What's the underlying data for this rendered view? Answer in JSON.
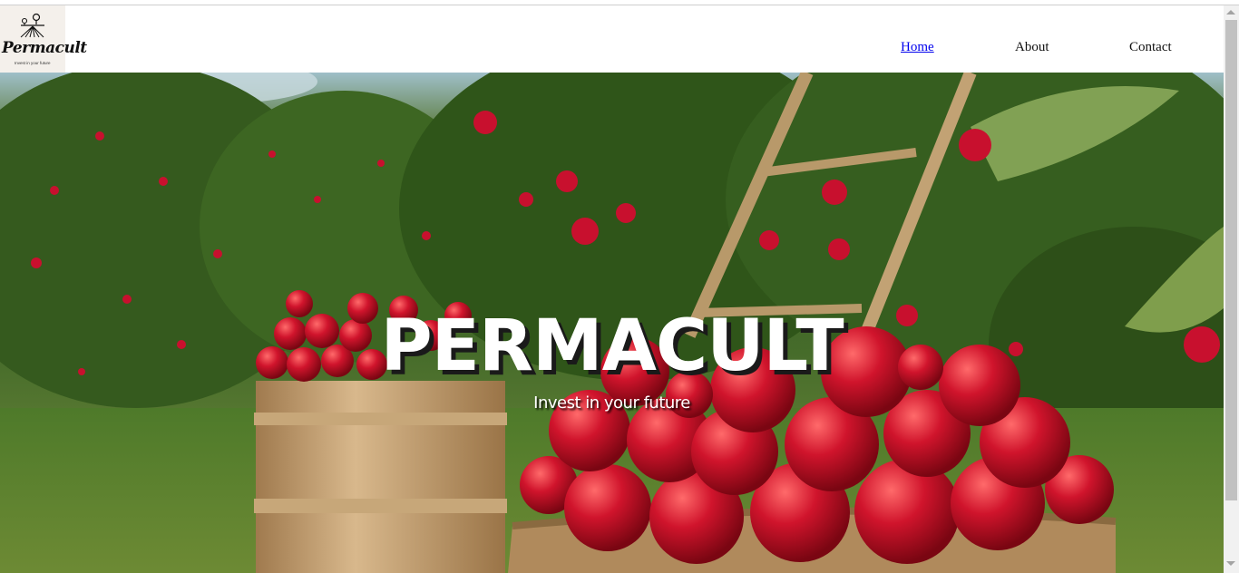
{
  "brand": {
    "name": "Permacult",
    "tagline": "Invest in your future",
    "logo_icon": "tree-garden-icon"
  },
  "nav": {
    "items": [
      {
        "label": "Home",
        "active": true
      },
      {
        "label": "About",
        "active": false
      },
      {
        "label": "Contact",
        "active": false
      }
    ]
  },
  "hero": {
    "title": "PERMACULT",
    "subtitle": "Invest in your future",
    "image": "apple-orchard-barrels-photo"
  },
  "colors": {
    "link_active": "#0000ee",
    "apple_red": "#c8102e",
    "barrel_wood": "#c9a57a"
  }
}
